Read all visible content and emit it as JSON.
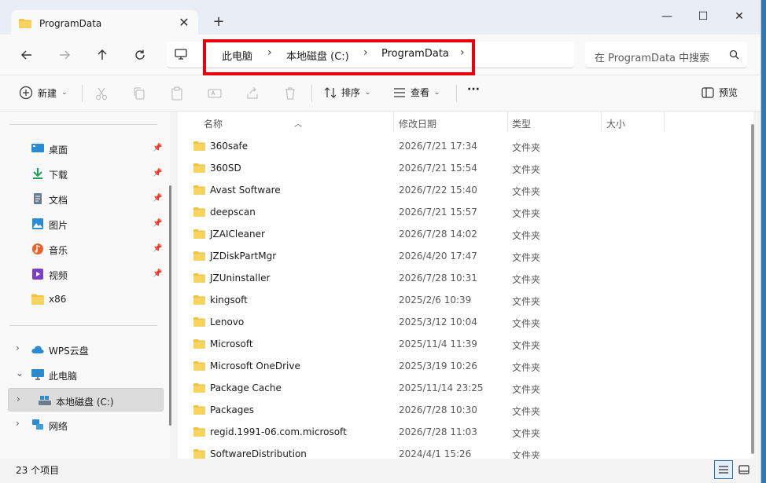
{
  "tab": {
    "title": "ProgramData",
    "close": "✕",
    "new_tab": "+"
  },
  "window_controls": {
    "minimize": "—",
    "maximize": "☐",
    "close": "✕"
  },
  "breadcrumb": {
    "items": [
      "此电脑",
      "本地磁盘 (C:)",
      "ProgramData"
    ],
    "separator": "›"
  },
  "search": {
    "placeholder": "在 ProgramData 中搜索"
  },
  "toolbar": {
    "new_label": "新建",
    "sort_label": "排序",
    "view_label": "查看",
    "more_label": "···",
    "preview_label": "预览"
  },
  "sidebar": {
    "quick": [
      {
        "label": "桌面",
        "icon": "desktop-icon",
        "pinned": true
      },
      {
        "label": "下载",
        "icon": "download-icon",
        "pinned": true
      },
      {
        "label": "文档",
        "icon": "document-icon",
        "pinned": true
      },
      {
        "label": "图片",
        "icon": "pictures-icon",
        "pinned": true
      },
      {
        "label": "音乐",
        "icon": "music-icon",
        "pinned": true
      },
      {
        "label": "视频",
        "icon": "video-icon",
        "pinned": true
      },
      {
        "label": "x86",
        "icon": "folder-icon",
        "pinned": false
      }
    ],
    "tree": [
      {
        "label": "WPS云盘",
        "icon": "cloud-icon",
        "expanded": false
      },
      {
        "label": "此电脑",
        "icon": "computer-icon",
        "expanded": true
      },
      {
        "label": "本地磁盘 (C:)",
        "icon": "drive-icon",
        "expanded": false,
        "selected": true
      },
      {
        "label": "网络",
        "icon": "network-icon",
        "expanded": false
      }
    ]
  },
  "columns": {
    "name": "名称",
    "modified": "修改日期",
    "type": "类型",
    "size": "大小"
  },
  "files": [
    {
      "name": "360safe",
      "date": "2026/7/21 17:34",
      "type": "文件夹"
    },
    {
      "name": "360SD",
      "date": "2026/7/21 15:54",
      "type": "文件夹"
    },
    {
      "name": "Avast Software",
      "date": "2026/7/22 15:40",
      "type": "文件夹"
    },
    {
      "name": "deepscan",
      "date": "2026/7/21 15:57",
      "type": "文件夹"
    },
    {
      "name": "JZAICleaner",
      "date": "2026/7/28 14:02",
      "type": "文件夹"
    },
    {
      "name": "JZDiskPartMgr",
      "date": "2026/4/20 17:47",
      "type": "文件夹"
    },
    {
      "name": "JZUninstaller",
      "date": "2026/7/28 10:31",
      "type": "文件夹"
    },
    {
      "name": "kingsoft",
      "date": "2025/2/6 10:39",
      "type": "文件夹"
    },
    {
      "name": "Lenovo",
      "date": "2025/3/12 10:04",
      "type": "文件夹"
    },
    {
      "name": "Microsoft",
      "date": "2025/11/4 11:39",
      "type": "文件夹"
    },
    {
      "name": "Microsoft OneDrive",
      "date": "2025/3/19 10:26",
      "type": "文件夹"
    },
    {
      "name": "Package Cache",
      "date": "2025/11/14 23:25",
      "type": "文件夹"
    },
    {
      "name": "Packages",
      "date": "2026/7/28 10:30",
      "type": "文件夹"
    },
    {
      "name": "regid.1991-06.com.microsoft",
      "date": "2026/7/28 11:03",
      "type": "文件夹"
    },
    {
      "name": "SoftwareDistribution",
      "date": "2024/4/1 15:26",
      "type": "文件夹"
    }
  ],
  "status": {
    "count": "23 个项目"
  },
  "colors": {
    "highlight": "#e8000b",
    "folder": "#f4c33c",
    "accent": "#2b6ea8"
  }
}
